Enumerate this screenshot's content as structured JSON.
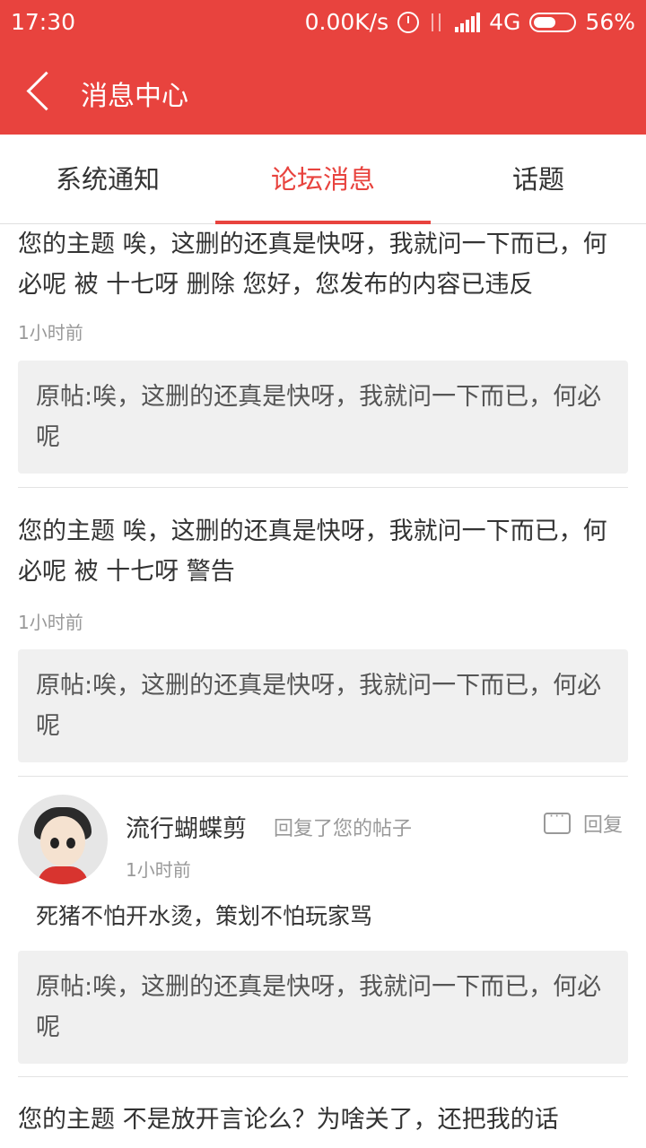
{
  "status": {
    "time": "17:30",
    "speed": "0.00K/s",
    "network": "4G",
    "battery": "56%",
    "battery_level": 0.56
  },
  "header": {
    "title": "消息中心"
  },
  "tabs": [
    {
      "label": "系统通知"
    },
    {
      "label": "论坛消息"
    },
    {
      "label": "话题"
    }
  ],
  "messages": [
    {
      "text": "您的主题 唉，这删的还真是快呀，我就问一下而已，何必呢 被 十七呀 删除 您好，您发布的内容已违反",
      "time": "1小时前",
      "quote": "原帖:唉，这删的还真是快呀，我就问一下而已，何必呢"
    },
    {
      "text": "您的主题 唉，这删的还真是快呀，我就问一下而已，何必呢 被 十七呀 警告",
      "time": "1小时前",
      "quote": "原帖:唉，这删的还真是快呀，我就问一下而已，何必呢"
    },
    {
      "user": "流行蝴蝶剪",
      "action": "回复了您的帖子",
      "reply_label": "回复",
      "time": "1小时前",
      "text": "死猪不怕开水烫，策划不怕玩家骂",
      "quote": "原帖:唉，这删的还真是快呀，我就问一下而已，何必呢"
    },
    {
      "text": "您的主题 不是放开言论么？为啥关了，还把我的话"
    }
  ]
}
